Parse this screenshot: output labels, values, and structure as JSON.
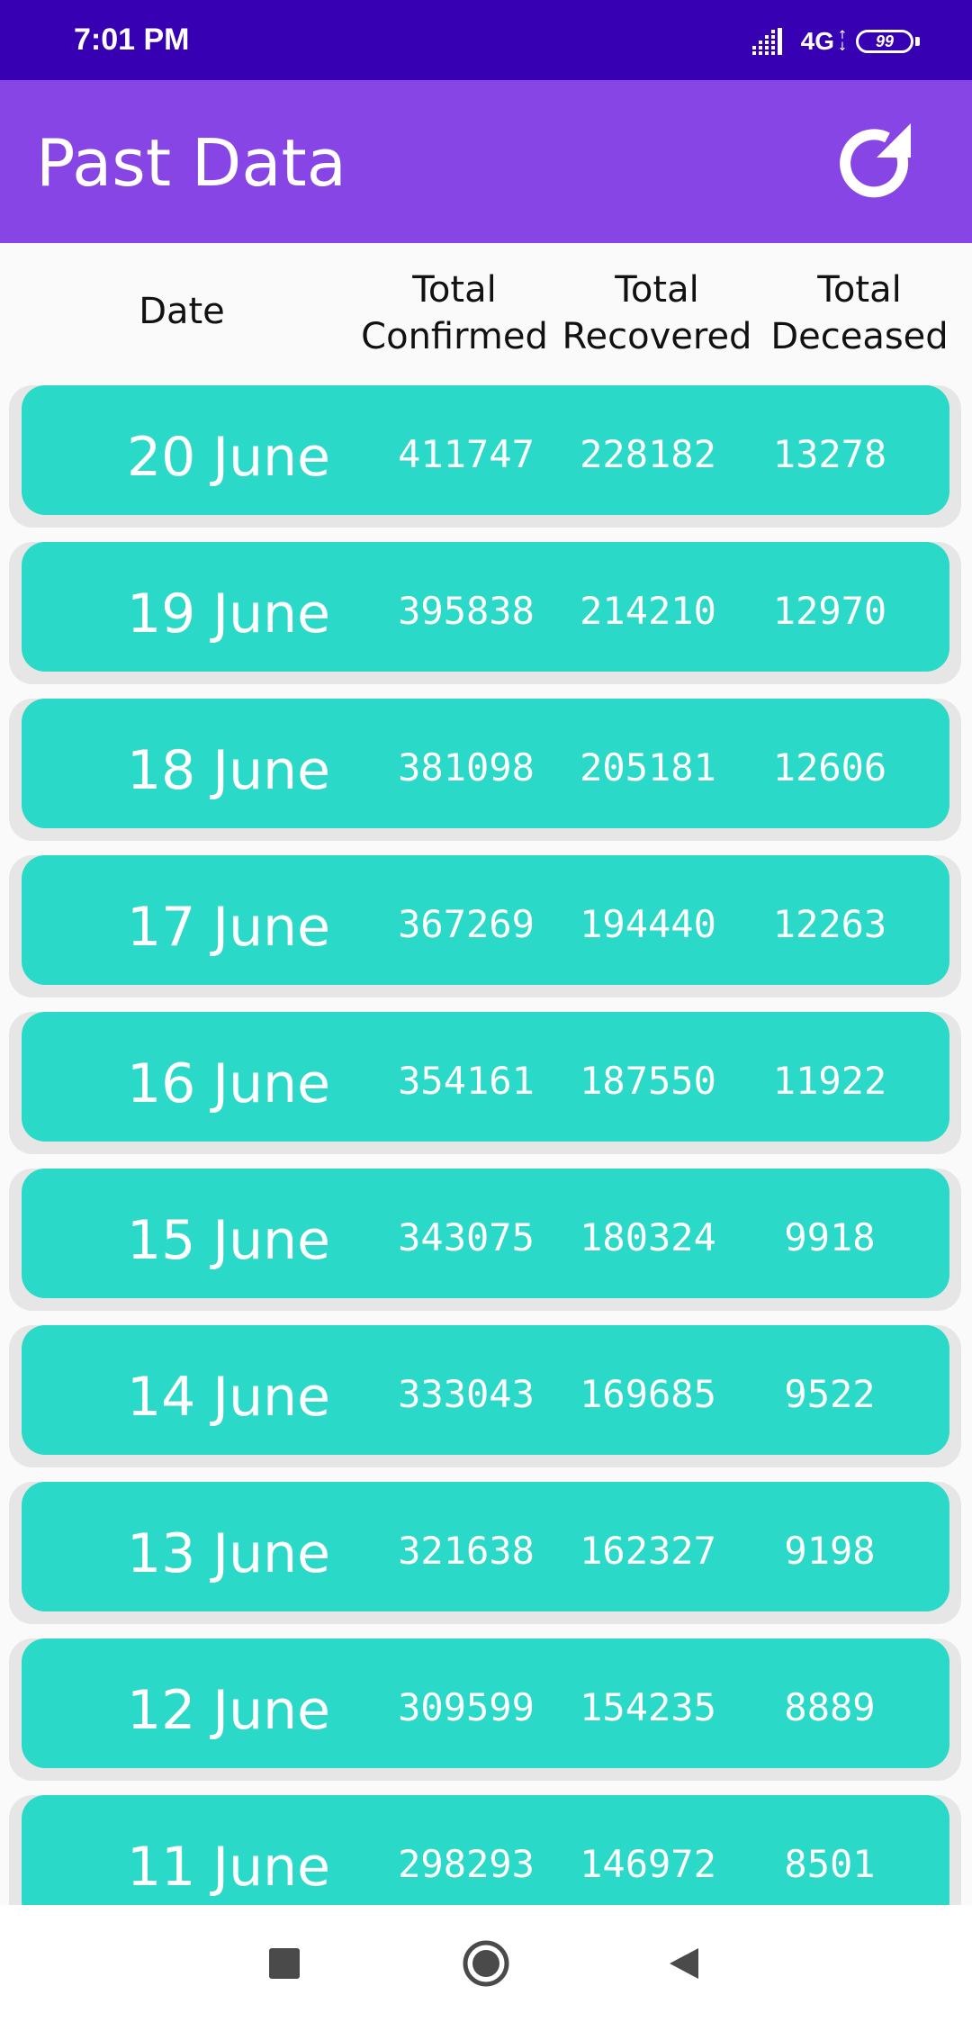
{
  "status_bar": {
    "time": "7:01 PM",
    "network": "4G",
    "battery": "99",
    "icons": [
      "signal-icon",
      "network-arrows-icon",
      "battery-icon"
    ]
  },
  "app_bar": {
    "title": "Past Data",
    "refresh_icon": "refresh-icon"
  },
  "table_header": {
    "date": "Date",
    "confirmed": "Total\nConfirmed",
    "recovered": "Total\nRecovered",
    "deceased": "Total\nDeceased"
  },
  "rows": [
    {
      "date": "20 June",
      "confirmed": "411747",
      "recovered": "228182",
      "deceased": "13278"
    },
    {
      "date": "19 June",
      "confirmed": "395838",
      "recovered": "214210",
      "deceased": "12970"
    },
    {
      "date": "18 June",
      "confirmed": "381098",
      "recovered": "205181",
      "deceased": "12606"
    },
    {
      "date": "17 June",
      "confirmed": "367269",
      "recovered": "194440",
      "deceased": "12263"
    },
    {
      "date": "16 June",
      "confirmed": "354161",
      "recovered": "187550",
      "deceased": "11922"
    },
    {
      "date": "15 June",
      "confirmed": "343075",
      "recovered": "180324",
      "deceased": "9918"
    },
    {
      "date": "14 June",
      "confirmed": "333043",
      "recovered": "169685",
      "deceased": "9522"
    },
    {
      "date": "13 June",
      "confirmed": "321638",
      "recovered": "162327",
      "deceased": "9198"
    },
    {
      "date": "12 June",
      "confirmed": "309599",
      "recovered": "154235",
      "deceased": "8889"
    },
    {
      "date": "11 June",
      "confirmed": "298293",
      "recovered": "146972",
      "deceased": "8501"
    }
  ],
  "nav_bar": {
    "icons": [
      "recents-square-icon",
      "home-circle-icon",
      "back-triangle-icon"
    ]
  },
  "colors": {
    "status_bar": "#3700b3",
    "app_bar": "#8745e6",
    "row_card": "#2bd9c9",
    "row_shadow": "#e6e6e6",
    "background": "#fafafa"
  }
}
